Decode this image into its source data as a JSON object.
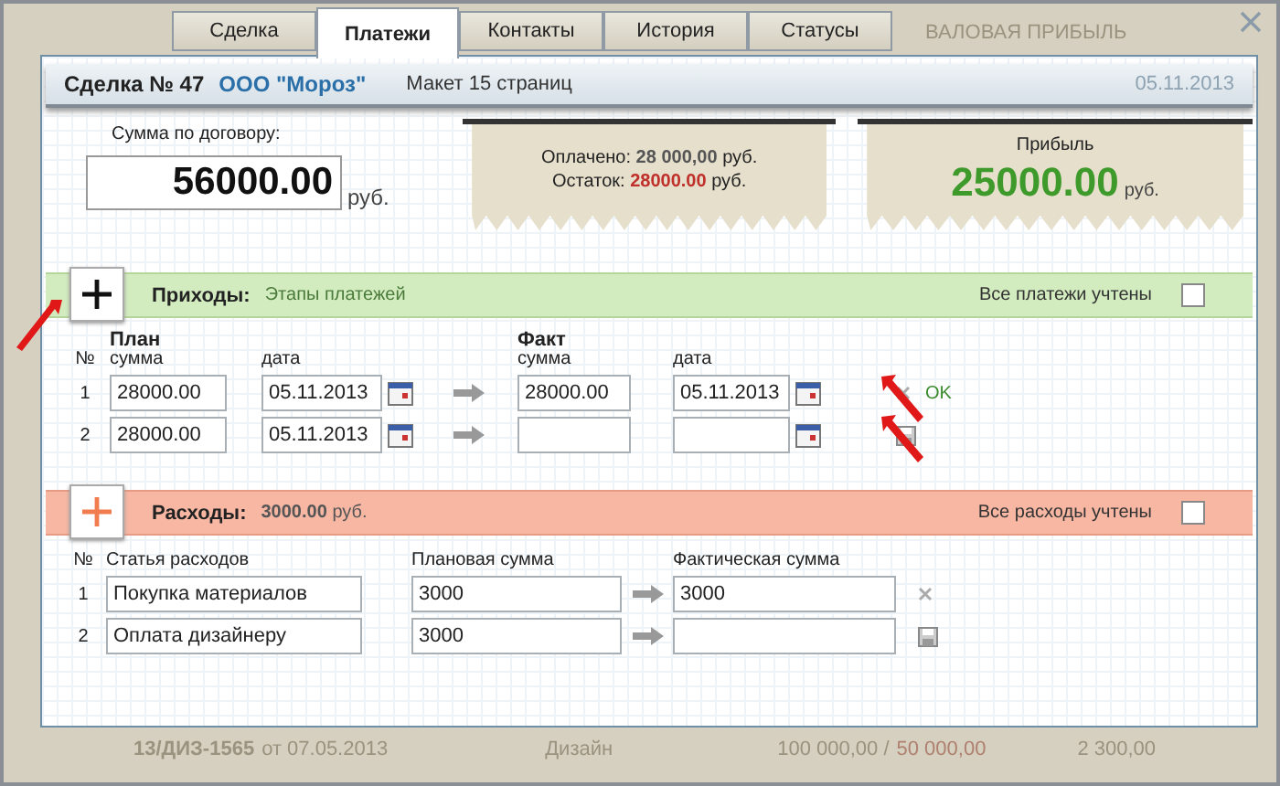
{
  "tabs": [
    {
      "label": "Сделка",
      "selected": false
    },
    {
      "label": "Платежи",
      "selected": true
    },
    {
      "label": "Контакты",
      "selected": false
    },
    {
      "label": "История",
      "selected": false
    },
    {
      "label": "Статусы",
      "selected": false
    }
  ],
  "background": {
    "column_header": "ВАЛОВАЯ ПРИБЫЛЬ",
    "row": {
      "contract": "13/ДИЗ-1565",
      "date": "от 07.05.2013",
      "type": "Дизайн",
      "total": "100 000,00 /",
      "paid": "50 000,00",
      "profit": "2 300,00"
    }
  },
  "deal": {
    "title": "Сделка № 47",
    "client": "ООО \"Мороз\"",
    "description": "Макет 15 страниц",
    "date": "05.11.2013"
  },
  "contract_sum": {
    "label": "Сумма по договору:",
    "value": "56000.00",
    "currency": "руб."
  },
  "paid_card": {
    "paid_label": "Оплачено:",
    "paid_value": "28 000,00",
    "paid_currency": "руб.",
    "remaining_label": "Остаток:",
    "remaining_value": "28000.00",
    "remaining_currency": "руб."
  },
  "profit_card": {
    "label": "Прибыль",
    "value": "25000.00",
    "currency": "руб."
  },
  "income": {
    "title": "Приходы:",
    "subtitle": "Этапы платежей",
    "all_label": "Все платежи учтены",
    "all_checked": false,
    "headers": {
      "no": "№",
      "plan": "План",
      "fact": "Факт",
      "plan_sum": "сумма",
      "plan_date": "дата",
      "fact_sum": "сумма",
      "fact_date": "дата"
    },
    "rows": [
      {
        "no": "1",
        "plan_sum": "28000.00",
        "plan_date": "05.11.2013",
        "fact_sum": "28000.00",
        "fact_date": "05.11.2013",
        "kind": "confirmed",
        "status": "OK"
      },
      {
        "no": "2",
        "plan_sum": "28000.00",
        "plan_date": "05.11.2013",
        "kind": "unsaved"
      }
    ]
  },
  "expenses": {
    "title": "Расходы:",
    "total": "3000.00",
    "currency": "руб.",
    "all_label": "Все расходы учтены",
    "all_checked": false,
    "headers": {
      "no": "№",
      "item": "Статья расходов",
      "plan": "Плановая сумма",
      "fact": "Фактическая сумма"
    },
    "rows": [
      {
        "no": "1",
        "item": "Покупка материалов",
        "plan": "3000",
        "fact": "3000",
        "kind": "confirmed"
      },
      {
        "no": "2",
        "item": "Оплата дизайнеру",
        "plan": "3000",
        "kind": "unsaved"
      }
    ]
  }
}
